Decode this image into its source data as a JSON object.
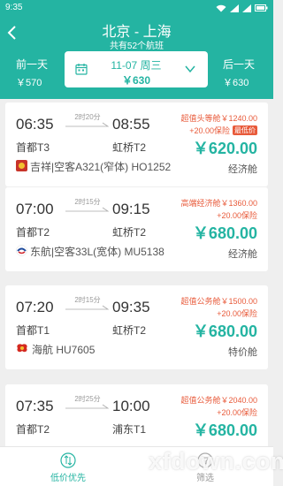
{
  "status_bar": {
    "time": "9:35"
  },
  "header": {
    "route": "北京 - 上海",
    "subtitle": "共有52个航班",
    "prev_day": {
      "label": "前一天",
      "price": "￥570"
    },
    "selected_date": {
      "date": "11-07 周三",
      "price": "￥630"
    },
    "next_day": {
      "label": "后一天",
      "price": "￥630"
    }
  },
  "flights": [
    {
      "dep_time": "06:35",
      "duration": "2时20分",
      "arr_time": "08:55",
      "dep_airport": "首都T3",
      "arr_airport": "虹桥T2",
      "airline": "吉祥|空客A321(窄体) HO1252",
      "promo": "超值头等舱￥1240.00",
      "insurance": "+20.00保险",
      "badge": "最低价",
      "price": "￥620.00",
      "cabin": "经济舱",
      "logo_color": "#c8342a"
    },
    {
      "dep_time": "07:00",
      "duration": "2时15分",
      "arr_time": "09:15",
      "dep_airport": "首都T2",
      "arr_airport": "虹桥T2",
      "airline": "东航|空客33L(宽体) MU5138",
      "promo": "高端经济舱￥1360.00",
      "insurance": "+20.00保险",
      "badge": "",
      "price": "￥680.00",
      "cabin": "经济舱",
      "logo_color": "#1e4a9c"
    },
    {
      "dep_time": "07:20",
      "duration": "2时15分",
      "arr_time": "09:35",
      "dep_airport": "首都T1",
      "arr_airport": "虹桥T2",
      "airline": "海航 HU7605",
      "promo": "超值公务舱￥1500.00",
      "insurance": "+20.00保险",
      "badge": "",
      "price": "￥680.00",
      "cabin": "特价舱",
      "logo_color": "#d42a20"
    },
    {
      "dep_time": "07:35",
      "duration": "2时25分",
      "arr_time": "10:00",
      "dep_airport": "首都T2",
      "arr_airport": "浦东T1",
      "airline": "",
      "promo": "超值公务舱￥2040.00",
      "insurance": "+20.00保险",
      "badge": "",
      "price": "￥680.00",
      "cabin": "",
      "logo_color": "#1e4a9c"
    }
  ],
  "bottom_tabs": {
    "low_price": "低价优先",
    "filter": "筛选"
  },
  "watermark": "xfdown.com",
  "colors": {
    "accent": "#24b4a2",
    "promo": "#e85a3a"
  }
}
